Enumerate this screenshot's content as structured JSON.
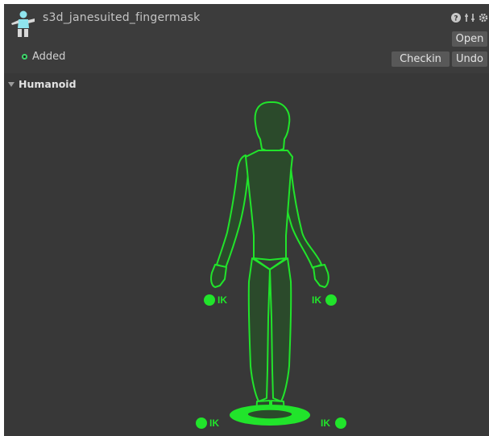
{
  "header": {
    "asset_name": "s3d_janesuited_fingermask",
    "icons": [
      "help-icon",
      "preset-icon",
      "settings-icon"
    ],
    "open_label": "Open",
    "checkin_label": "Checkin",
    "undo_label": "Undo",
    "status": {
      "label": "Added",
      "color": "#3fd16a"
    }
  },
  "section": {
    "title": "Humanoid",
    "expanded": true
  },
  "avatar": {
    "body_color": "#21e42b",
    "ik_handles": [
      {
        "label": "IK",
        "name": "left-hand-ik"
      },
      {
        "label": "IK",
        "name": "right-hand-ik"
      },
      {
        "label": "IK",
        "name": "left-foot-ik"
      },
      {
        "label": "IK",
        "name": "right-foot-ik"
      }
    ]
  }
}
